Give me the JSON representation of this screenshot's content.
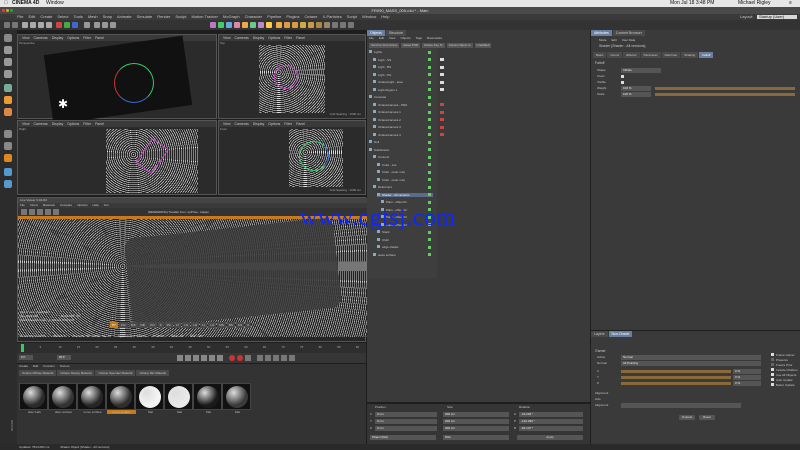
{
  "mac_menu": {
    "app": "CINEMA 4D",
    "window": "Window",
    "clock": "Mon Jul 18  3:48 PM",
    "user": "Michael Rigley"
  },
  "window_title": "FR090_MASS_005.c4d * - Main",
  "layout_label": "Layout:",
  "layout_value": "Startup (User)",
  "menu": [
    "File",
    "Edit",
    "Create",
    "Select",
    "Tools",
    "Mesh",
    "Snap",
    "Animate",
    "Simulate",
    "Render",
    "Sculpt",
    "Motion Tracker",
    "MoGraph",
    "Character",
    "Pipeline",
    "Plugins",
    "Octane",
    "X-Particles",
    "Script",
    "Window",
    "Help"
  ],
  "viewports": [
    {
      "name": "Perspective",
      "menus": [
        "View",
        "Cameras",
        "Display",
        "Options",
        "Filter",
        "Panel"
      ],
      "footer": ""
    },
    {
      "name": "Top",
      "menus": [
        "View",
        "Cameras",
        "Display",
        "Options",
        "Filter",
        "Panel"
      ],
      "footer": "Grid Spacing : 1000 cm"
    },
    {
      "name": "Right",
      "menus": [
        "View",
        "Cameras",
        "Display",
        "Options",
        "Filter",
        "Panel"
      ],
      "footer": ""
    },
    {
      "name": "Front",
      "menus": [
        "View",
        "Cameras",
        "Display",
        "Options",
        "Filter",
        "Panel"
      ],
      "footer": "Grid Spacing : 1000 cm"
    }
  ],
  "live_viewer": {
    "title": "Live Viewer 3.02-R2",
    "menus": [
      "File",
      "Cloud",
      "Materials",
      "Compare",
      "Options",
      "Help",
      "Gui"
    ],
    "status": "[RENDERING]  Tonable from: opPrise - Hasps",
    "memory_title": "Out of core used/max:",
    "grey_label": "Grey8/16:",
    "grey_val": "0/0",
    "rgb_label": "Rgb32/64:",
    "rgb_val": "0/0",
    "vram_label": "Used/free/total vram:",
    "vram_val": "2.13Gb/2.7Gb/4Gb",
    "mode_tabs": [
      "PT",
      "Info",
      "DiF",
      "DIF",
      "Pnl",
      "Z",
      "Pin",
      "LT",
      "LO",
      "LD",
      "LL",
      "LO",
      "MS",
      "BS",
      "CS",
      "A"
    ],
    "rendering_label": "Rendering:",
    "rendering_pct": "0.025%",
    "ms_label": "Ms/sec:",
    "ms_val": "0",
    "time_label": "Time:",
    "time_val": "00 : 00 : 00/00 : 11 : 55",
    "spp_label": "Spp/maxspp:",
    "spp_val": "6/1000",
    "tri_label": "Tri:",
    "tri_val": "0/3m",
    "mesh_label": "Mesh:",
    "mesh_val": "94",
    "hair_label": "Hair:",
    "hair_val": "140"
  },
  "timeline": {
    "frame": "0 F",
    "end": "90 F",
    "ticks": [
      "0",
      "5",
      "10",
      "15",
      "20",
      "25",
      "30",
      "35",
      "40",
      "45",
      "50",
      "55",
      "60",
      "65",
      "70",
      "75",
      "80",
      "85",
      "90"
    ]
  },
  "material_manager": {
    "menus": [
      "Create",
      "Edit",
      "Function",
      "Texture"
    ],
    "tabs": [
      "Octane Diffuse Material",
      "Octane Glossy Material",
      "Octane Specular Material",
      "Octane Mix Material"
    ],
    "materials": [
      {
        "name": "alien bark",
        "color": "#2a2a2a"
      },
      {
        "name": "alien surface",
        "color": "#333"
      },
      {
        "name": "nerve surface",
        "color": "#262626"
      },
      {
        "name": "nerve surface",
        "color": "#2d2d2d"
      },
      {
        "name": "Mat",
        "color": "#f5f5f5"
      },
      {
        "name": "Mat",
        "color": "#eaeaea"
      },
      {
        "name": "Mat",
        "color": "#1a1a1a"
      },
      {
        "name": "Mat",
        "color": "#3a3a3a"
      }
    ]
  },
  "status_bar": "Updated: 7814.083 ms",
  "status_bar_right": "Shader Object [Shader - All versions]",
  "object_manager": {
    "tabs": [
      "Objects",
      "Structure"
    ],
    "menus": [
      "File",
      "Edit",
      "View",
      "Objects",
      "Tags",
      "Bookmarks"
    ],
    "buttons": [
      "Scroll to First Active",
      "Reset PSR",
      "Delete Key Sr",
      "Center Object to",
      "Unaddled"
    ],
    "items": [
      {
        "name": "Lights",
        "indent": 0
      },
      {
        "name": "Light - SS",
        "indent": 1
      },
      {
        "name": "Light - BS",
        "indent": 1
      },
      {
        "name": "Light - PH",
        "indent": 1
      },
      {
        "name": "OctaneLight - area",
        "indent": 1
      },
      {
        "name": "Light Region 1",
        "indent": 1
      },
      {
        "name": "Cameras",
        "indent": 0
      },
      {
        "name": "OctaneCamera - PRH",
        "indent": 1
      },
      {
        "name": "OctaneCamera 1",
        "indent": 1
      },
      {
        "name": "OctaneCamera 2",
        "indent": 1
      },
      {
        "name": "OctaneCamera 3",
        "indent": 1
      },
      {
        "name": "OctaneCamera 4",
        "indent": 1
      },
      {
        "name": "Null",
        "indent": 0
      },
      {
        "name": "Subdivision",
        "indent": 0
      },
      {
        "name": "Connect",
        "indent": 1
      },
      {
        "name": "Cube - sss",
        "indent": 2
      },
      {
        "name": "Cloth - outer mist",
        "indent": 2
      },
      {
        "name": "Cloth - outer mist",
        "indent": 2
      },
      {
        "name": "Deformers",
        "indent": 1
      },
      {
        "name": "Shader - All versions",
        "indent": 2
      },
      {
        "name": "Plain - offset 01",
        "indent": 3
      },
      {
        "name": "Plain - offset 02",
        "indent": 3
      },
      {
        "name": "Plain - offset 03",
        "indent": 3
      },
      {
        "name": "Plain - offset 04",
        "indent": 3
      },
      {
        "name": "Stack",
        "indent": 2
      },
      {
        "name": "Cloth",
        "indent": 2
      },
      {
        "name": "edge shader",
        "indent": 2
      },
      {
        "name": "wave surface",
        "indent": 1
      }
    ]
  },
  "coordinates": {
    "headers": [
      "Position",
      "Size",
      "Rotation"
    ],
    "rows": [
      {
        "axis": "X",
        "pos": "0 cm",
        "size": "200 cm",
        "rot_axis": "H",
        "rot": "-16.203 °"
      },
      {
        "axis": "Y",
        "pos": "0 cm",
        "size": "200 cm",
        "rot_axis": "P",
        "rot": "-132.299 °"
      },
      {
        "axis": "Z",
        "pos": "0 cm",
        "size": "200 cm",
        "rot_axis": "B",
        "rot": "-81.137 °"
      }
    ],
    "mode": "Object (Rel)",
    "size_mode": "Size",
    "apply": "Apply"
  },
  "attributes": {
    "tabs": [
      "Attributes",
      "Content Browser"
    ],
    "menus": [
      "Mode",
      "Edit",
      "User Data"
    ],
    "object_title": "Shader [Shader - All versions]",
    "subtabs": [
      "Basic",
      "Coord.",
      "Effector",
      "Parameter",
      "Deformer",
      "Shading",
      "Falloff"
    ],
    "section": "Falloff",
    "fields": [
      {
        "label": "Shape",
        "value": "Infinite"
      },
      {
        "label": "Invert",
        "value": ""
      },
      {
        "label": "Visible",
        "value": ""
      },
      {
        "label": "Weight",
        "value": "100 %"
      },
      {
        "label": "Scale",
        "value": "100 %"
      }
    ]
  },
  "layers": {
    "tabs": [
      "Layers",
      "Non-Oracle"
    ],
    "section": "Gamer",
    "fields": [
      {
        "label": "Active",
        "value": "Normal"
      },
      {
        "label": "Normal",
        "value": "All Pointing"
      }
    ],
    "sliders": [
      {
        "label": "X",
        "value": "0 %"
      },
      {
        "label": "Y",
        "value": "0 %"
      },
      {
        "label": "Z",
        "value": "0 %"
      }
    ],
    "checkboxes": [
      "Frame Gamer",
      "Preserve",
      "Freeze Prior",
      "Include Children",
      "Use All Objects",
      "Auto Update",
      "Better Update"
    ],
    "alignment_label": "Alignment",
    "axis_label": "Axis",
    "aligner_label": "Alignment",
    "buttons": [
      "Outputs",
      "Reset"
    ]
  },
  "watermark": "www.cgtsj.com"
}
